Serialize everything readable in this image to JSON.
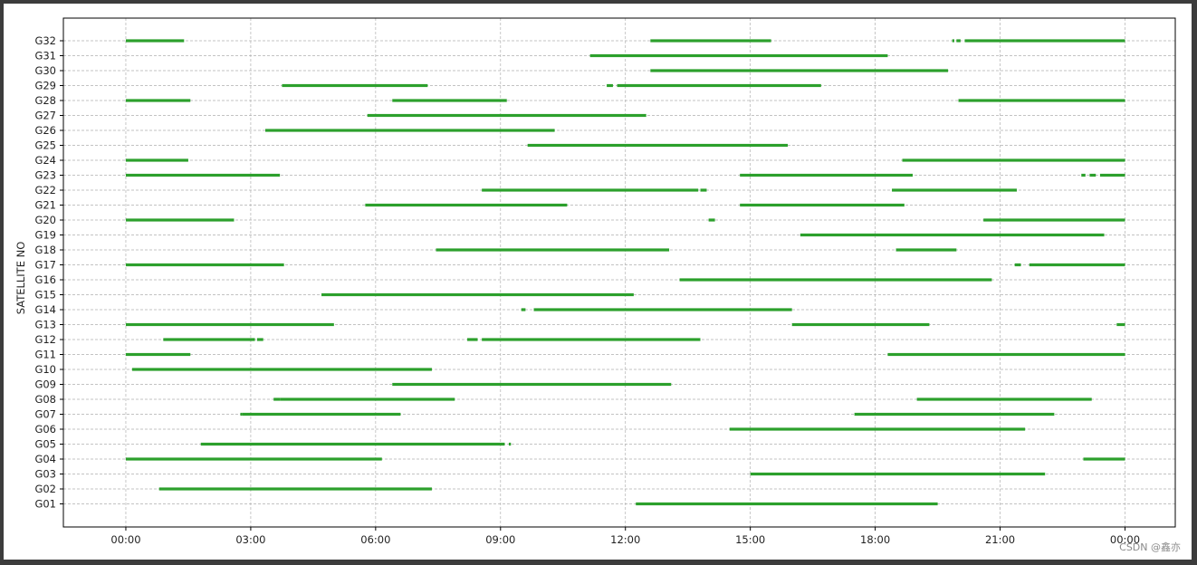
{
  "watermark": "CSDN @鑫亦",
  "colors": {
    "bar": "#2ca02c",
    "grid": "#b0b0b0",
    "axes": "#000000"
  },
  "chart_data": {
    "type": "bar",
    "orientation": "horizontal-timeline",
    "title": "",
    "xlabel": "",
    "ylabel": "SATELLITE NO",
    "grid": true,
    "xlim": [
      -0.0625,
      1.0503
    ],
    "x_ticks": [
      {
        "value": 0.0,
        "label": "00:00"
      },
      {
        "value": 0.125,
        "label": "03:00"
      },
      {
        "value": 0.25,
        "label": "06:00"
      },
      {
        "value": 0.375,
        "label": "09:00"
      },
      {
        "value": 0.5,
        "label": "12:00"
      },
      {
        "value": 0.625,
        "label": "15:00"
      },
      {
        "value": 0.75,
        "label": "18:00"
      },
      {
        "value": 0.875,
        "label": "21:00"
      },
      {
        "value": 1.0,
        "label": "00:00"
      }
    ],
    "categories": [
      "G01",
      "G02",
      "G03",
      "G04",
      "G05",
      "G06",
      "G07",
      "G08",
      "G09",
      "G10",
      "G11",
      "G12",
      "G13",
      "G14",
      "G15",
      "G16",
      "G17",
      "G18",
      "G19",
      "G20",
      "G21",
      "G22",
      "G23",
      "G24",
      "G25",
      "G26",
      "G27",
      "G28",
      "G29",
      "G30",
      "G31",
      "G32"
    ],
    "series": [
      {
        "sat": "G01",
        "intervals": [
          [
            0.5104,
            0.8125
          ]
        ]
      },
      {
        "sat": "G02",
        "intervals": [
          [
            0.0333,
            0.3063
          ]
        ]
      },
      {
        "sat": "G03",
        "intervals": [
          [
            0.625,
            0.92
          ]
        ]
      },
      {
        "sat": "G04",
        "intervals": [
          [
            0.0,
            0.2563
          ],
          [
            0.9583,
            1.0
          ]
        ]
      },
      {
        "sat": "G05",
        "intervals": [
          [
            0.075,
            0.3792
          ],
          [
            0.3833,
            0.3854
          ]
        ]
      },
      {
        "sat": "G06",
        "intervals": [
          [
            0.6042,
            0.9
          ]
        ]
      },
      {
        "sat": "G07",
        "intervals": [
          [
            0.1146,
            0.1167
          ],
          [
            0.1167,
            0.275
          ],
          [
            0.7292,
            0.9292
          ]
        ]
      },
      {
        "sat": "G08",
        "intervals": [
          [
            0.1479,
            0.1542
          ],
          [
            0.1542,
            0.3292
          ],
          [
            0.7917,
            0.9667
          ]
        ]
      },
      {
        "sat": "G09",
        "intervals": [
          [
            0.2667,
            0.5458
          ]
        ]
      },
      {
        "sat": "G10",
        "intervals": [
          [
            0.0063,
            0.3063
          ]
        ]
      },
      {
        "sat": "G11",
        "intervals": [
          [
            0.0,
            0.0646
          ],
          [
            0.7625,
            1.0
          ]
        ]
      },
      {
        "sat": "G12",
        "intervals": [
          [
            0.0375,
            0.1292
          ],
          [
            0.1313,
            0.1375
          ],
          [
            0.3417,
            0.3521
          ],
          [
            0.3563,
            0.575
          ]
        ]
      },
      {
        "sat": "G13",
        "intervals": [
          [
            0.0,
            0.2083
          ],
          [
            0.6667,
            0.8042
          ],
          [
            0.9917,
            1.0
          ]
        ]
      },
      {
        "sat": "G14",
        "intervals": [
          [
            0.3958,
            0.4
          ],
          [
            0.4083,
            0.6667
          ]
        ]
      },
      {
        "sat": "G15",
        "intervals": [
          [
            0.1958,
            0.5083
          ]
        ]
      },
      {
        "sat": "G16",
        "intervals": [
          [
            0.5542,
            0.8667
          ]
        ]
      },
      {
        "sat": "G17",
        "intervals": [
          [
            0.0,
            0.1583
          ],
          [
            0.8896,
            0.8958
          ],
          [
            0.9042,
            1.0
          ]
        ]
      },
      {
        "sat": "G18",
        "intervals": [
          [
            0.3104,
            0.5438
          ],
          [
            0.7708,
            0.8313
          ]
        ]
      },
      {
        "sat": "G19",
        "intervals": [
          [
            0.675,
            0.9792
          ]
        ]
      },
      {
        "sat": "G20",
        "intervals": [
          [
            0.0,
            0.1083
          ],
          [
            0.5833,
            0.5896
          ],
          [
            0.8583,
            1.0
          ]
        ]
      },
      {
        "sat": "G21",
        "intervals": [
          [
            0.2396,
            0.4417
          ],
          [
            0.6146,
            0.7792
          ]
        ]
      },
      {
        "sat": "G22",
        "intervals": [
          [
            0.3563,
            0.5729
          ],
          [
            0.575,
            0.5813
          ],
          [
            0.7667,
            0.8917
          ]
        ]
      },
      {
        "sat": "G23",
        "intervals": [
          [
            0.0,
            0.1542
          ],
          [
            0.6146,
            0.7875
          ],
          [
            0.9563,
            0.9604
          ],
          [
            0.9646,
            0.9708
          ],
          [
            0.975,
            1.0
          ]
        ]
      },
      {
        "sat": "G24",
        "intervals": [
          [
            0.0,
            0.0625
          ],
          [
            0.7771,
            1.0
          ]
        ]
      },
      {
        "sat": "G25",
        "intervals": [
          [
            0.4021,
            0.6625
          ]
        ]
      },
      {
        "sat": "G26",
        "intervals": [
          [
            0.1396,
            0.4292
          ]
        ]
      },
      {
        "sat": "G27",
        "intervals": [
          [
            0.2417,
            0.5208
          ]
        ]
      },
      {
        "sat": "G28",
        "intervals": [
          [
            0.0,
            0.0646
          ],
          [
            0.2667,
            0.3813
          ],
          [
            0.8333,
            1.0
          ]
        ]
      },
      {
        "sat": "G29",
        "intervals": [
          [
            0.1563,
            0.3021
          ],
          [
            0.4813,
            0.4875
          ],
          [
            0.4917,
            0.6958
          ]
        ]
      },
      {
        "sat": "G30",
        "intervals": [
          [
            0.525,
            0.8229
          ]
        ]
      },
      {
        "sat": "G31",
        "intervals": [
          [
            0.4646,
            0.7625
          ]
        ]
      },
      {
        "sat": "G32",
        "intervals": [
          [
            0.0,
            0.0583
          ],
          [
            0.525,
            0.6458
          ],
          [
            0.8271,
            0.8292
          ],
          [
            0.8313,
            0.8354
          ],
          [
            0.8396,
            1.0
          ]
        ]
      }
    ]
  }
}
